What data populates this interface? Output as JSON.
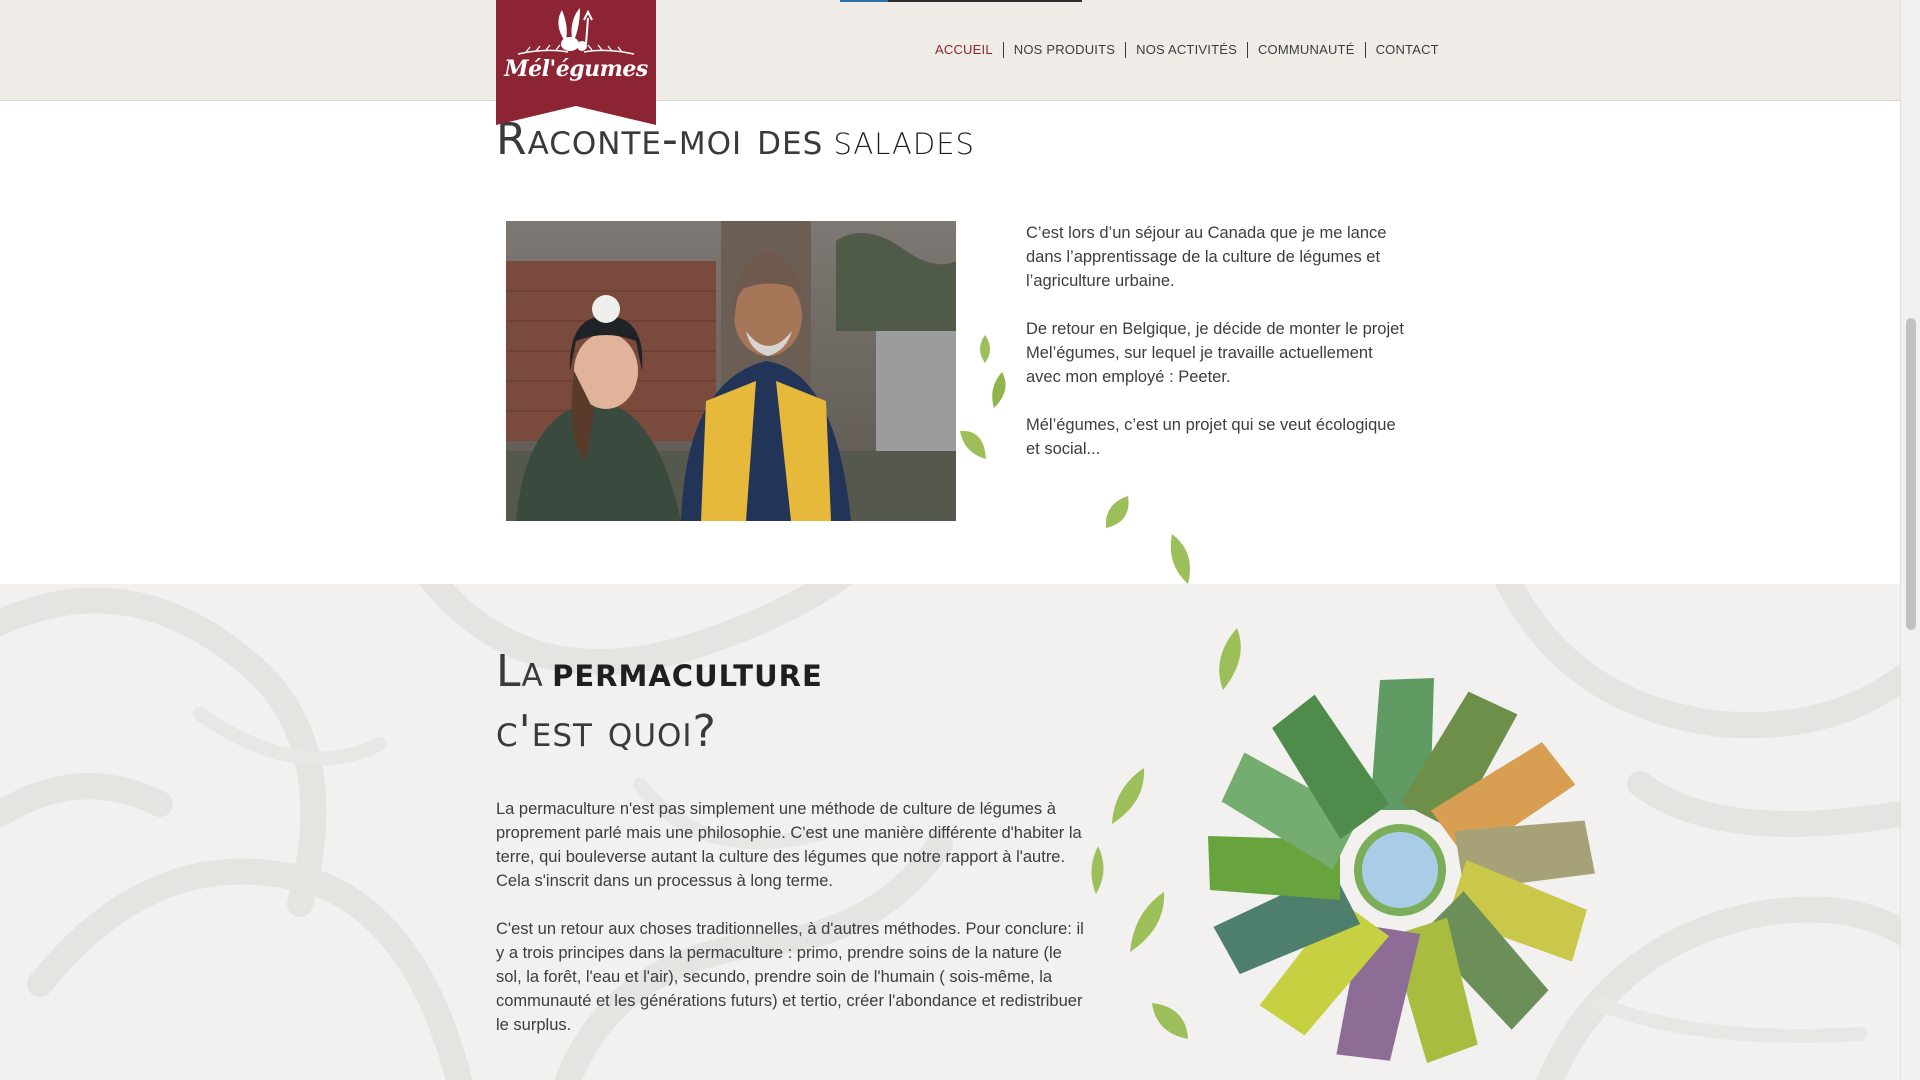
{
  "brand": {
    "name": "Mél'égumes",
    "color": "#8c2433"
  },
  "nav": {
    "items": [
      {
        "label": "ACCUEIL",
        "active": true
      },
      {
        "label": "NOS PRODUITS",
        "active": false
      },
      {
        "label": "NOS ACTIVITÉS",
        "active": false
      },
      {
        "label": "COMMUNAUTÉ",
        "active": false
      },
      {
        "label": "CONTACT",
        "active": false
      }
    ]
  },
  "section_story": {
    "title_part1": "Raconte-moi des",
    "title_part2": "salades",
    "paragraphs": [
      "C’est lors d’un séjour au Canada que je me lance dans l’apprentissage de la culture de légumes et l’agriculture urbaine.",
      "De retour en Belgique, je décide de monter le projet Mel’égumes, sur lequel je travaille actuellement avec mon employé : Peeter.",
      "Mél’égumes, c’est un projet qui se veut écologique et social..."
    ]
  },
  "section_permaculture": {
    "title_line1_part1": "La",
    "title_line1_part2": "permaculture",
    "title_line2": "c'est quoi?",
    "paragraphs": [
      "La permaculture n'est pas simplement une méthode de culture de légumes à proprement parlé mais une philosophie. C'est une manière différente d'habiter la terre, qui bouleverse autant la culture des légumes que notre rapport à l'autre. Cela s'inscrit dans un processus à long terme.",
      "C'est un retour aux choses traditionnelles, à d'autres méthodes. Pour conclure: il y a trois principes dans la permaculture : primo, prendre soins de la nature (le sol, la forêt, l'eau et l'air), secundo, prendre soin de l'humain ( sois-même, la communauté et les générations futurs) et tertio, créer l'abondance et redistribuer le surplus."
    ]
  },
  "icons": [
    "vegetables-logo-icon",
    "leaf-icon",
    "garden-wheel-illustration"
  ]
}
